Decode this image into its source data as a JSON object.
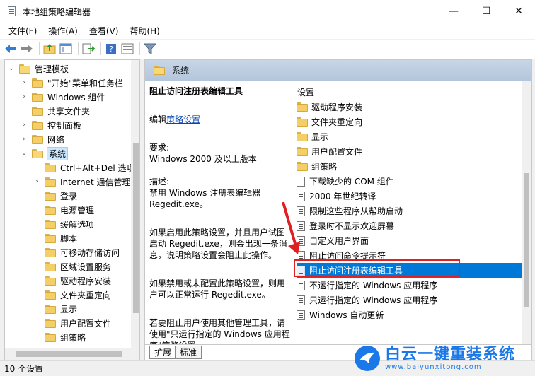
{
  "window": {
    "title": "本地组策略编辑器",
    "controls": {
      "minimize": "—",
      "maximize": "☐",
      "close": "✕"
    }
  },
  "menu": {
    "items": [
      "文件(F)",
      "操作(A)",
      "查看(V)",
      "帮助(H)"
    ]
  },
  "toolbar": {
    "icons": [
      "back-arrow-icon",
      "forward-arrow-icon",
      "up-folder-icon",
      "show-hide-tree-icon",
      "export-icon",
      "help-icon",
      "properties-icon",
      "filter-icon"
    ]
  },
  "tree": {
    "items": [
      {
        "label": "管理模板",
        "expander": "⌄"
      },
      {
        "label": "\"开始\"菜单和任务栏",
        "expander": "›"
      },
      {
        "label": "Windows 组件",
        "expander": "›"
      },
      {
        "label": "共享文件夹",
        "expander": ""
      },
      {
        "label": "控制面板",
        "expander": "›"
      },
      {
        "label": "网络",
        "expander": "›"
      },
      {
        "label": "系统",
        "expander": "⌄"
      },
      {
        "label": "Ctrl+Alt+Del 选项",
        "expander": ""
      },
      {
        "label": "Internet 通信管理",
        "expander": "›"
      },
      {
        "label": "登录",
        "expander": ""
      },
      {
        "label": "电源管理",
        "expander": ""
      },
      {
        "label": "缓解选项",
        "expander": ""
      },
      {
        "label": "脚本",
        "expander": ""
      },
      {
        "label": "可移动存储访问",
        "expander": ""
      },
      {
        "label": "区域设置服务",
        "expander": ""
      },
      {
        "label": "驱动程序安装",
        "expander": ""
      },
      {
        "label": "文件夹重定向",
        "expander": ""
      },
      {
        "label": "显示",
        "expander": ""
      },
      {
        "label": "用户配置文件",
        "expander": ""
      },
      {
        "label": "组策略",
        "expander": ""
      }
    ]
  },
  "right": {
    "header": "系统",
    "description": {
      "title": "阻止访问注册表编辑工具",
      "edit_prefix": "编辑",
      "edit_link": "策略设置",
      "req_label": "要求:",
      "req_value": "Windows 2000 及以上版本",
      "desc_label": "描述:",
      "desc_value": "禁用 Windows 注册表编辑器 Regedit.exe。",
      "p1": "如果启用此策略设置，并且用户试图启动 Regedit.exe，则会出现一条消息，说明策略设置会阻止此操作。",
      "p2": "如果禁用或未配置此策略设置，则用户可以正常运行 Regedit.exe。",
      "p3": "若要阻止用户使用其他管理工具，请使用\"只运行指定的 Windows 应用程序\"策略设置。"
    },
    "list_header": "设置",
    "list": [
      {
        "type": "folder",
        "label": "驱动程序安装"
      },
      {
        "type": "folder",
        "label": "文件夹重定向"
      },
      {
        "type": "folder",
        "label": "显示"
      },
      {
        "type": "folder",
        "label": "用户配置文件"
      },
      {
        "type": "folder",
        "label": "组策略"
      },
      {
        "type": "setting",
        "label": "下载缺少的 COM 组件"
      },
      {
        "type": "setting",
        "label": "2000 年世纪转译"
      },
      {
        "type": "setting",
        "label": "限制这些程序从帮助启动"
      },
      {
        "type": "setting",
        "label": "登录时不显示欢迎屏幕"
      },
      {
        "type": "setting",
        "label": "自定义用户界面"
      },
      {
        "type": "setting",
        "label": "阻止访问命令提示符"
      },
      {
        "type": "setting",
        "label": "阻止访问注册表编辑工具",
        "selected": true
      },
      {
        "type": "setting",
        "label": "不运行指定的 Windows 应用程序"
      },
      {
        "type": "setting",
        "label": "只运行指定的 Windows 应用程序"
      },
      {
        "type": "setting",
        "label": "Windows 自动更新"
      }
    ],
    "tabs": [
      "扩展",
      "标准"
    ]
  },
  "status": {
    "text": "10 个设置"
  },
  "watermark": {
    "brand": "白云一键重装系统",
    "url": "www.baiyunxitong.com"
  },
  "colors": {
    "selection": "#0078d7",
    "highlight_box": "#e02020",
    "watermark": "#1b78e8"
  }
}
